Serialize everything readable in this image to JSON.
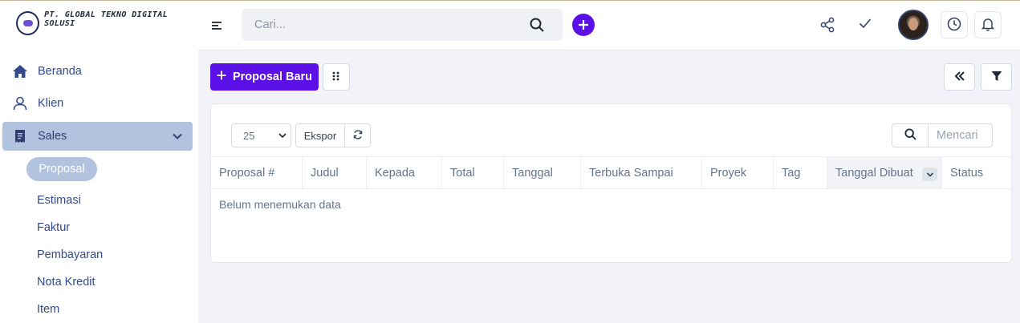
{
  "brand": {
    "name": "PT. GLOBAL TEKNO DIGITAL SOLUSI"
  },
  "sidebar": {
    "items": [
      {
        "label": "Beranda",
        "icon": "home-icon"
      },
      {
        "label": "Klien",
        "icon": "user-icon"
      },
      {
        "label": "Sales",
        "icon": "receipt-icon",
        "expanded": true
      }
    ],
    "sales_sub": [
      "Proposal",
      "Estimasi",
      "Faktur",
      "Pembayaran",
      "Nota Kredit",
      "Item"
    ],
    "active_sub": "Proposal"
  },
  "header": {
    "search_placeholder": "Cari..."
  },
  "toolbar": {
    "new_proposal_label": "Proposal Baru"
  },
  "table": {
    "page_length": "25",
    "export_label": "Ekspor",
    "search_placeholder": "Mencari",
    "columns": [
      "Proposal #",
      "Judul",
      "Kepada",
      "Total",
      "Tanggal",
      "Terbuka Sampai",
      "Proyek",
      "Tag",
      "Tanggal Dibuat",
      "Status"
    ],
    "sorted_column": "Tanggal Dibuat",
    "empty_text": "Belum menemukan data"
  },
  "colors": {
    "accent": "#5b10e8",
    "sidebar_active": "#b1c3de",
    "nav_text": "#334a8c"
  }
}
